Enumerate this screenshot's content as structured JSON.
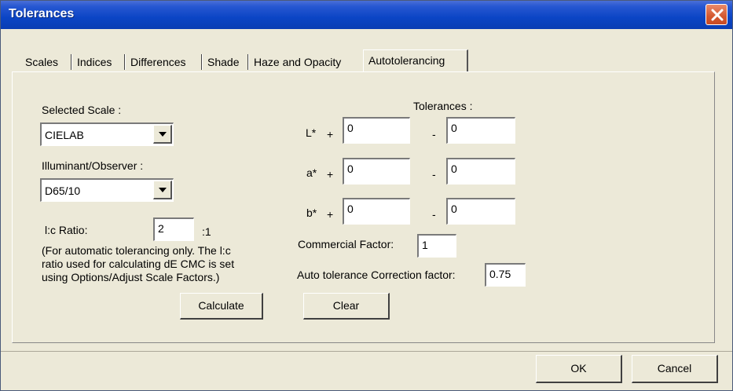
{
  "window": {
    "title": "Tolerances"
  },
  "tabs": [
    {
      "label": "Scales"
    },
    {
      "label": "Indices"
    },
    {
      "label": "Differences"
    },
    {
      "label": "Shade"
    },
    {
      "label": "Haze and Opacity"
    },
    {
      "label": "Autotolerancing",
      "active": true
    }
  ],
  "left": {
    "selected_scale_label": "Selected Scale :",
    "selected_scale_value": "CIELAB",
    "illuminant_label": "Illuminant/Observer :",
    "illuminant_value": "D65/10",
    "lc_ratio_label": "l:c Ratio:",
    "lc_ratio_value": "2",
    "lc_ratio_suffix": ":1",
    "note_line1": "(For automatic tolerancing only.  The l:c",
    "note_line2": "ratio used for calculating dE CMC is set",
    "note_line3": "using Options/Adjust Scale Factors.)",
    "calculate_label": "Calculate"
  },
  "tolerances": {
    "heading": "Tolerances :",
    "plus": "+",
    "minus": "-",
    "rows": [
      {
        "label": "L*",
        "plus_value": "0",
        "minus_value": "0"
      },
      {
        "label": "a*",
        "plus_value": "0",
        "minus_value": "0"
      },
      {
        "label": "b*",
        "plus_value": "0",
        "minus_value": "0"
      }
    ],
    "commercial_factor_label": "Commercial Factor:",
    "commercial_factor_value": "1",
    "auto_correction_label": "Auto tolerance Correction factor:",
    "auto_correction_value": "0.75",
    "clear_label": "Clear"
  },
  "footer": {
    "ok_label": "OK",
    "cancel_label": "Cancel"
  }
}
